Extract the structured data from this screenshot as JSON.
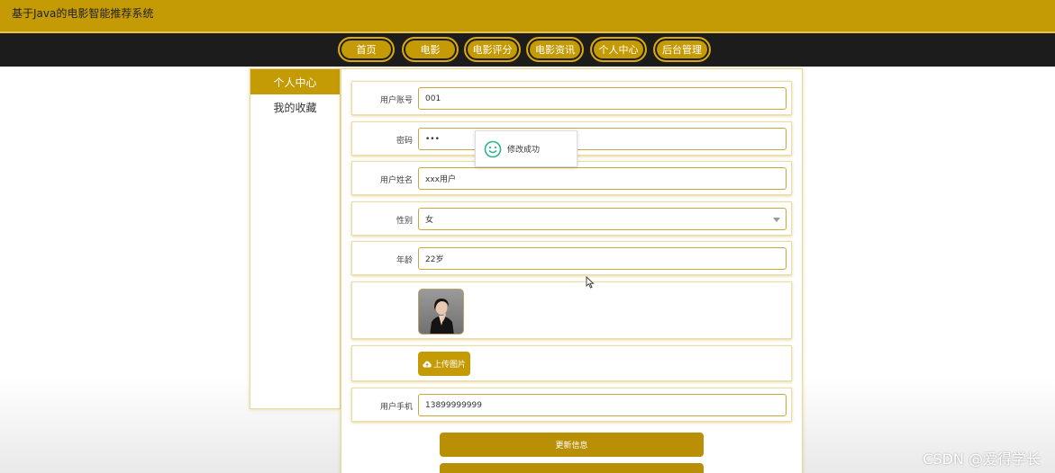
{
  "header": {
    "site_title": "基于Java的电影智能推荐系统"
  },
  "nav": {
    "items": [
      "首页",
      "电影",
      "电影评分",
      "电影资讯",
      "个人中心",
      "后台管理"
    ]
  },
  "sidebar": {
    "items": [
      {
        "label": "个人中心",
        "active": true
      },
      {
        "label": "我的收藏",
        "active": false
      }
    ]
  },
  "form": {
    "account": {
      "label": "用户账号",
      "value": "001"
    },
    "password": {
      "label": "密码",
      "value": "•••"
    },
    "name": {
      "label": "用户姓名",
      "value": "xxx用户"
    },
    "gender": {
      "label": "性别",
      "value": "女"
    },
    "age": {
      "label": "年龄",
      "value": "22岁"
    },
    "upload_label": "上传图片",
    "phone": {
      "label": "用户手机",
      "value": "13899999999"
    },
    "update_button": "更新信息"
  },
  "toast": {
    "message": "修改成功",
    "icon": "smile-icon"
  },
  "watermark": "CSDN @爱得学长",
  "colors": {
    "brand": "#c49a05",
    "nav_bg": "#1c1c1c",
    "toast_icon": "#2bb48c"
  }
}
